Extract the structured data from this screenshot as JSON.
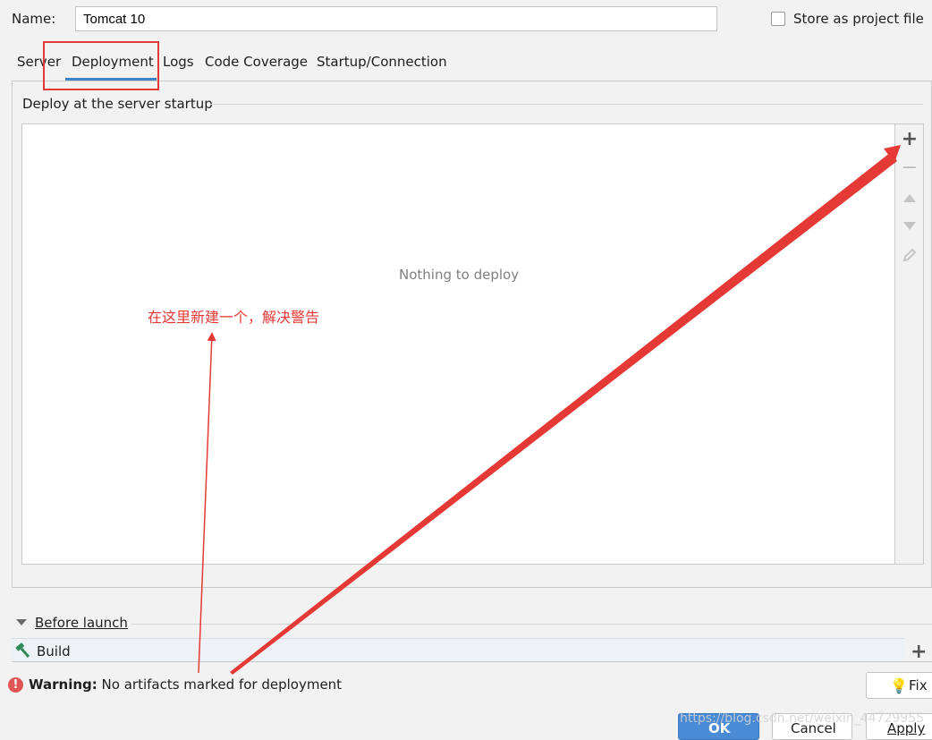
{
  "form": {
    "name_label": "Name:",
    "name_value": "Tomcat 10",
    "store_label": "Store as project file"
  },
  "tabs": [
    {
      "label": "Server"
    },
    {
      "label": "Deployment"
    },
    {
      "label": "Logs"
    },
    {
      "label": "Code Coverage"
    },
    {
      "label": "Startup/Connection"
    }
  ],
  "active_tab": "Deployment",
  "deploy": {
    "section_title": "Deploy at the server startup",
    "empty_text": "Nothing to deploy",
    "toolbar_icons": [
      "plus-icon",
      "minus-icon",
      "move-up-icon",
      "move-down-icon",
      "edit-icon"
    ]
  },
  "before_launch": {
    "label": "Before launch",
    "items": [
      {
        "label": "Build",
        "icon": "hammer-icon"
      }
    ]
  },
  "warning": {
    "label": "Warning:",
    "message": "No artifacts marked for deployment",
    "fix_label": "Fix"
  },
  "buttons": {
    "ok": "OK",
    "cancel": "Cancel",
    "apply": "Apply"
  },
  "annotation": {
    "text": "在这里新建一个，解决警告",
    "color": "#e53935"
  },
  "watermark": "https://blog.csdn.net/weixin_44729955",
  "colors": {
    "accent": "#4083c9",
    "highlight": "#e53935",
    "warning": "#e05555"
  }
}
